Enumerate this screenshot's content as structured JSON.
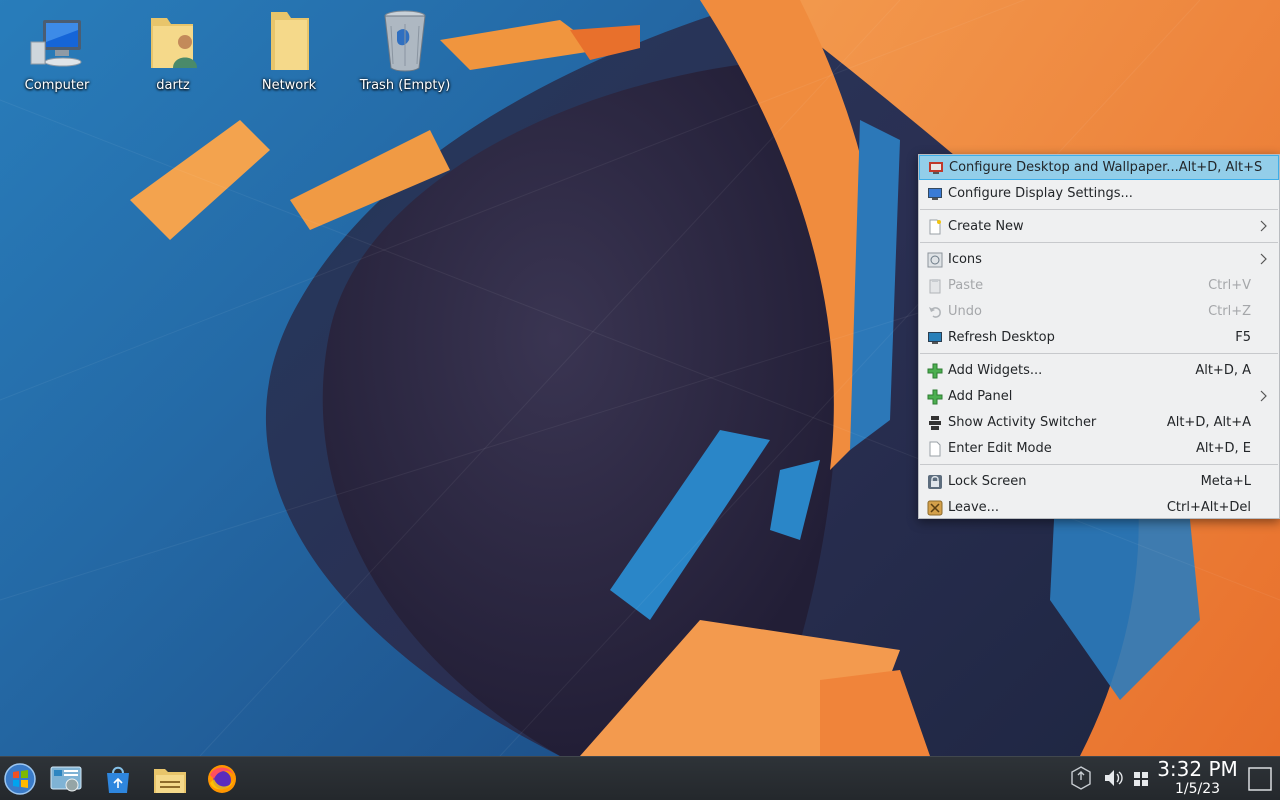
{
  "desktop_icons": [
    {
      "label": "Computer"
    },
    {
      "label": "dartz"
    },
    {
      "label": "Network"
    },
    {
      "label": "Trash (Empty)"
    }
  ],
  "context_menu": {
    "items": [
      {
        "label": "Configure Desktop and Wallpaper...",
        "shortcut": "Alt+D, Alt+S",
        "icon": "configure-desktop-icon",
        "highlighted": true
      },
      {
        "label": "Configure Display Settings...",
        "shortcut": "",
        "icon": "display-icon"
      },
      {
        "label": "Create New",
        "shortcut": "",
        "icon": "new-document-icon",
        "submenu": true
      },
      {
        "label": "Icons",
        "shortcut": "",
        "icon": "icons-icon",
        "submenu": true
      },
      {
        "label": "Paste",
        "shortcut": "Ctrl+V",
        "icon": "paste-icon",
        "disabled": true
      },
      {
        "label": "Undo",
        "shortcut": "Ctrl+Z",
        "icon": "undo-icon",
        "disabled": true
      },
      {
        "label": "Refresh Desktop",
        "shortcut": "F5",
        "icon": "refresh-desktop-icon"
      },
      {
        "label": "Add Widgets...",
        "shortcut": "Alt+D, A",
        "icon": "add-icon"
      },
      {
        "label": "Add Panel",
        "shortcut": "",
        "icon": "add-icon",
        "submenu": true
      },
      {
        "label": "Show Activity Switcher",
        "shortcut": "Alt+D, Alt+A",
        "icon": "activities-icon"
      },
      {
        "label": "Enter Edit Mode",
        "shortcut": "Alt+D, E",
        "icon": "edit-mode-icon"
      },
      {
        "label": "Lock Screen",
        "shortcut": "Meta+L",
        "icon": "lock-icon"
      },
      {
        "label": "Leave...",
        "shortcut": "Ctrl+Alt+Del",
        "icon": "leave-icon"
      }
    ]
  },
  "taskbar": {
    "launchers": [
      "start-menu-icon",
      "system-settings-icon",
      "software-store-icon",
      "file-manager-icon",
      "firefox-icon"
    ],
    "tray": [
      "updates-icon",
      "volume-icon",
      "virtual-desktops-icon",
      "show-desktop-icon"
    ],
    "clock_time": "3:32 PM",
    "clock_date": "1/5/23"
  },
  "colors": {
    "menu_bg": "#eff0f1",
    "menu_highlight": "#93cee9",
    "menu_highlight_border": "#3daee9",
    "wallpaper_orange": "#f0843a",
    "wallpaper_blue": "#1f7fc0",
    "taskbar_bg": "#2a2e32"
  }
}
